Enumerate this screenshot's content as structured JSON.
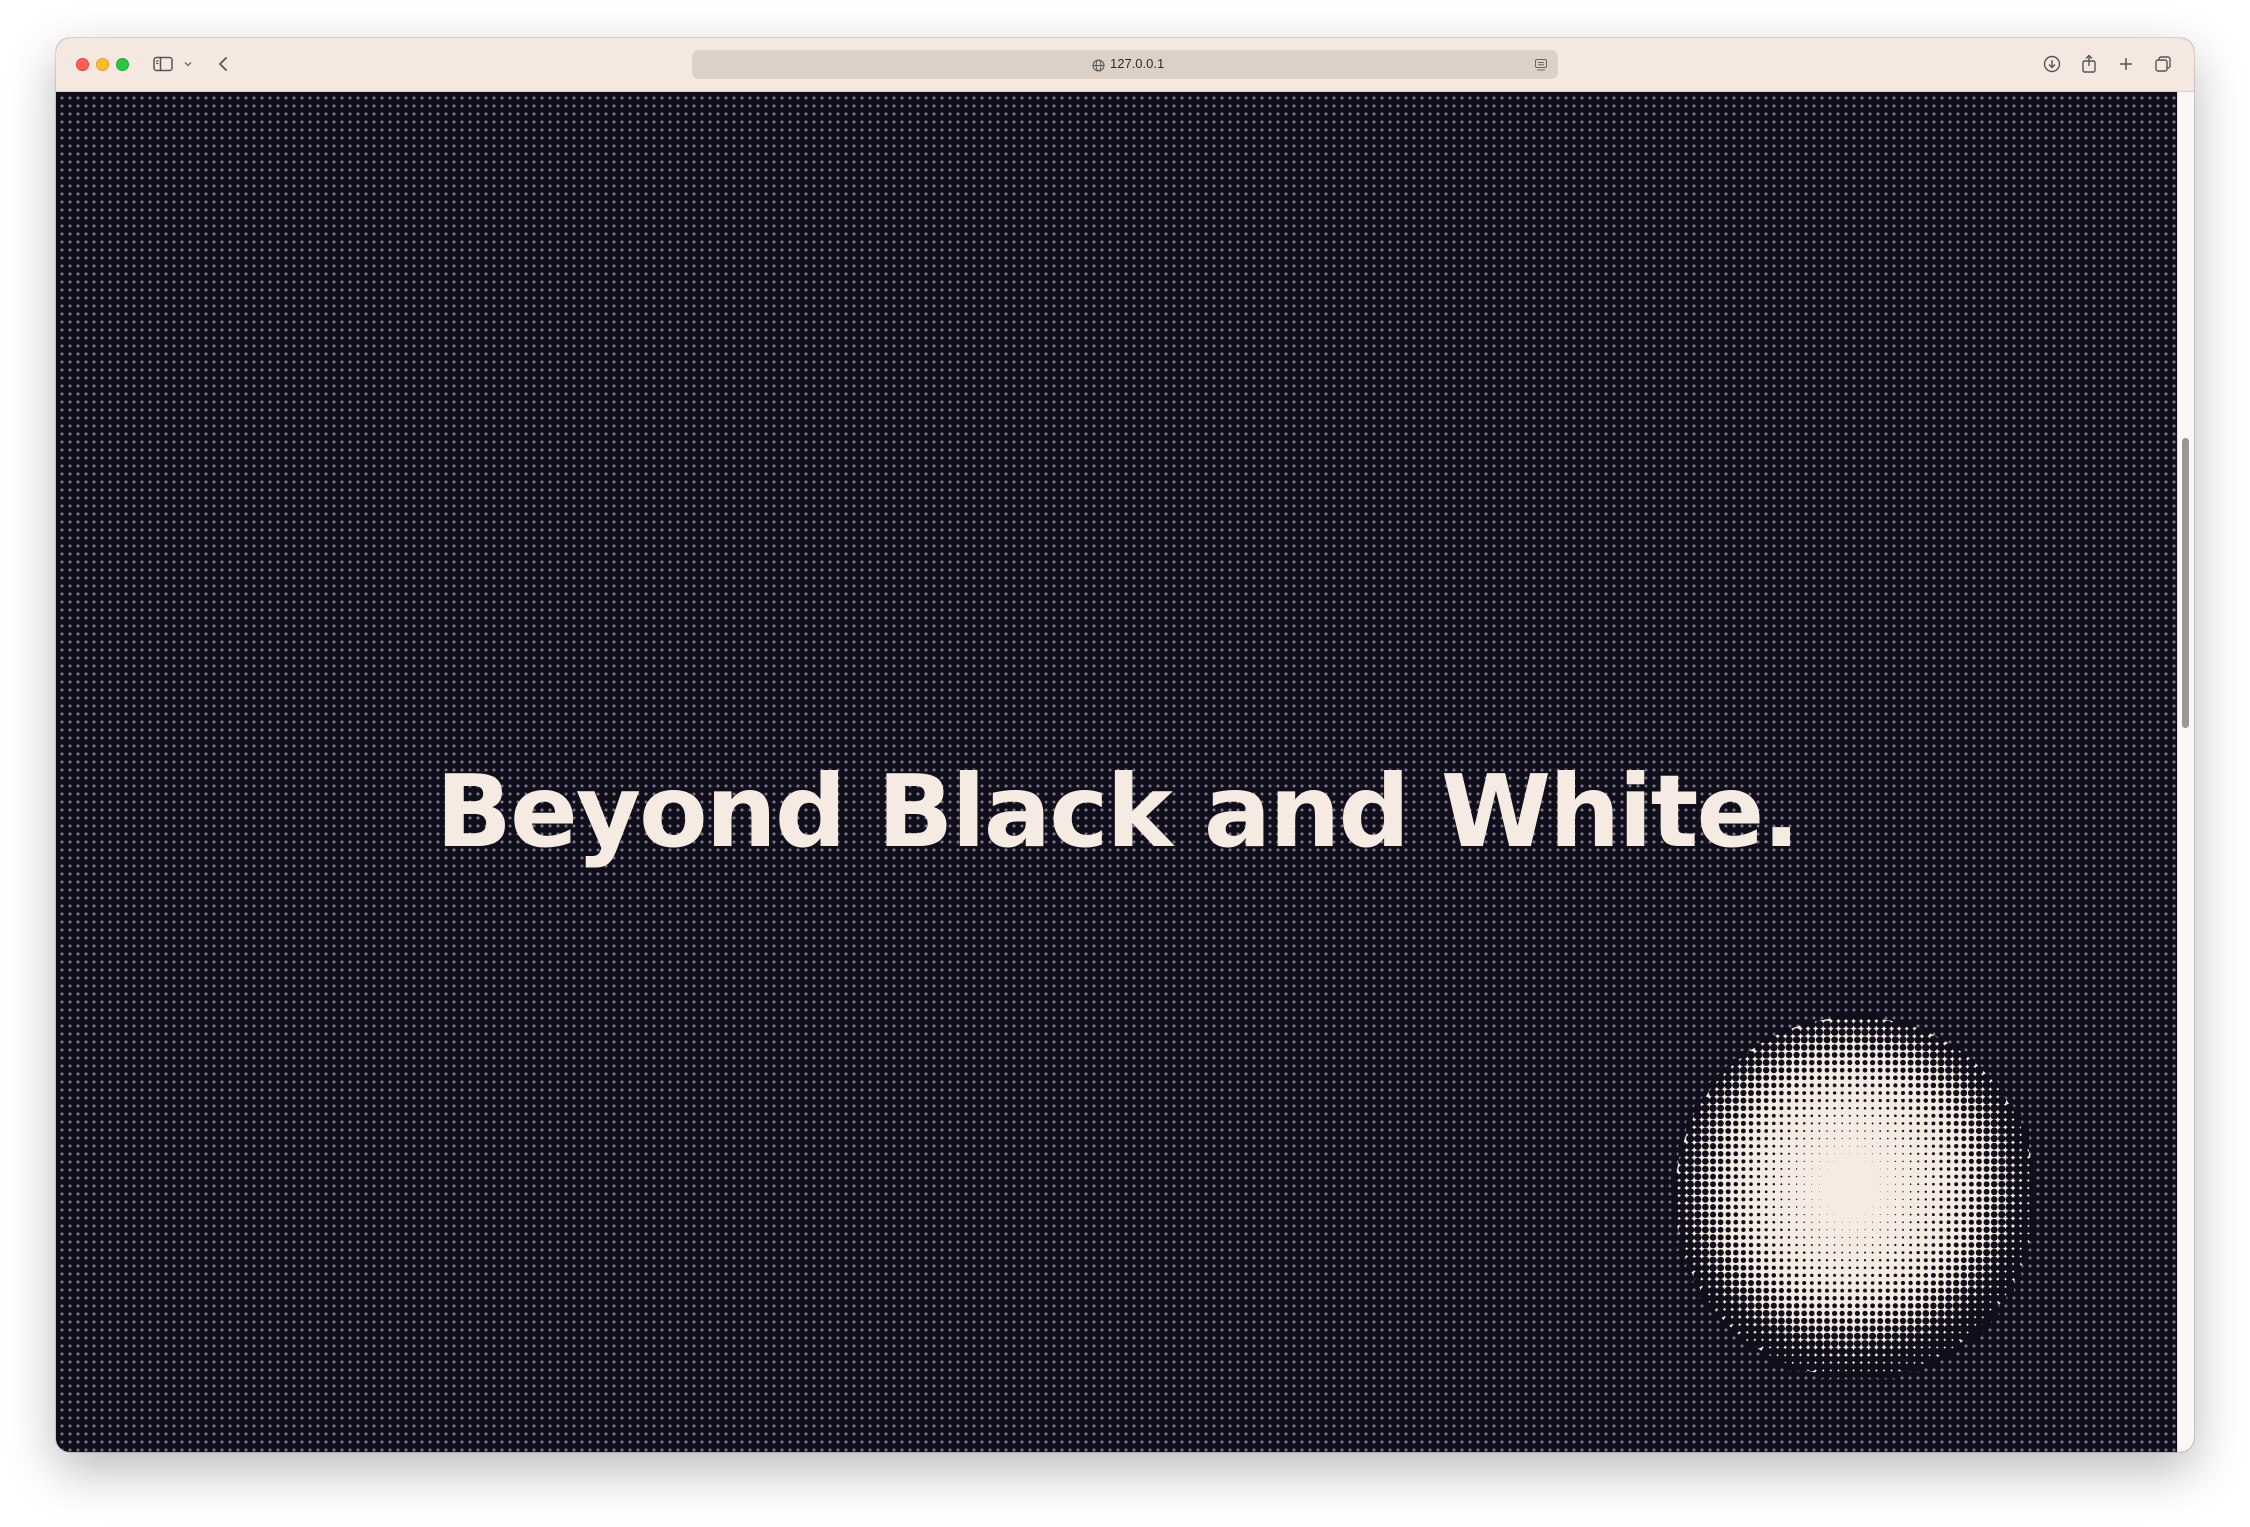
{
  "browser": {
    "url": "127.0.0.1"
  },
  "page": {
    "headline": "Beyond Black and White."
  },
  "icons": {
    "sidebar": "sidebar-icon",
    "back": "chevron-left-icon",
    "download": "download-icon",
    "share": "share-icon",
    "new_tab": "plus-icon",
    "tabs": "tab-overview-icon"
  },
  "colors": {
    "background": "#0f0e1a",
    "text": "#f6ebe2",
    "toolbar": "#f4e8e0"
  }
}
